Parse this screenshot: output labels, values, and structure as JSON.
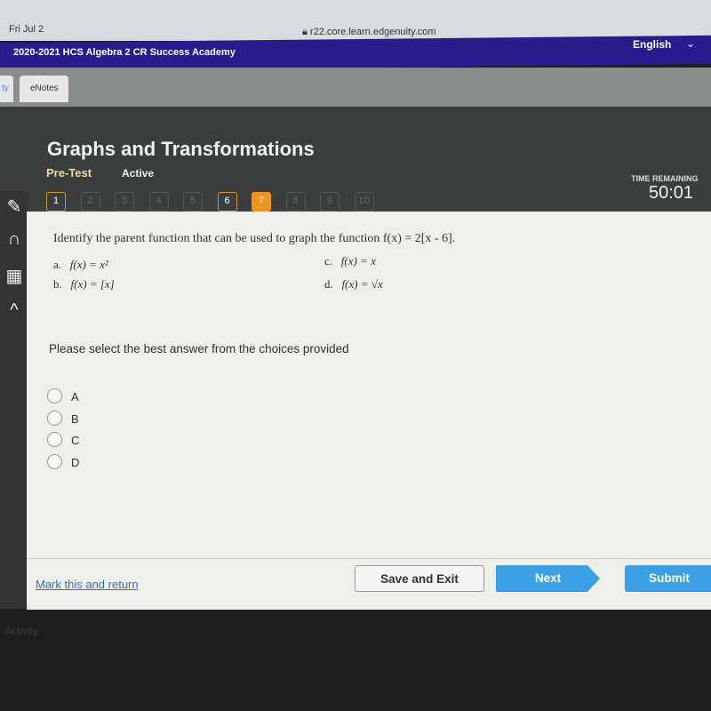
{
  "browser": {
    "date": "Fri Jul 2",
    "url": "r22.core.learn.edgenuity.com"
  },
  "header": {
    "course": "2020-2021 HCS Algebra 2 CR Success Academy",
    "language": "English"
  },
  "tabs": [
    {
      "label": "ty"
    },
    {
      "label": "eNotes"
    }
  ],
  "activity": {
    "title": "Graphs and Transformations",
    "type": "Pre-Test",
    "status": "Active"
  },
  "question_nav": [
    {
      "n": "1",
      "state": "answered"
    },
    {
      "n": "2",
      "state": "locked"
    },
    {
      "n": "3",
      "state": "locked"
    },
    {
      "n": "4",
      "state": "locked"
    },
    {
      "n": "5",
      "state": "locked"
    },
    {
      "n": "6",
      "state": "answered"
    },
    {
      "n": "7",
      "state": "current"
    },
    {
      "n": "8",
      "state": "locked"
    },
    {
      "n": "9",
      "state": "locked"
    },
    {
      "n": "10",
      "state": "locked"
    }
  ],
  "timer": {
    "label": "TIME REMAINING",
    "value": "50:01"
  },
  "question": {
    "prompt": "Identify the parent function that can be used to graph the function f(x) = 2[x - 6].",
    "choices": [
      {
        "letter": "a.",
        "text": "f(x) = x²"
      },
      {
        "letter": "b.",
        "text": "f(x) = [x]"
      },
      {
        "letter": "c.",
        "text": "f(x) = x"
      },
      {
        "letter": "d.",
        "text": "f(x) = √x"
      }
    ]
  },
  "instruction": "Please select the best answer from the choices provided",
  "options": [
    "A",
    "B",
    "C",
    "D"
  ],
  "footer": {
    "mark": "Mark this and return",
    "save": "Save and Exit",
    "next": "Next",
    "submit": "Submit"
  },
  "bottom_label": "Activity",
  "colors": {
    "header": "#2a1b8f",
    "current_question": "#f0941e",
    "primary_button": "#3aa0e3"
  }
}
